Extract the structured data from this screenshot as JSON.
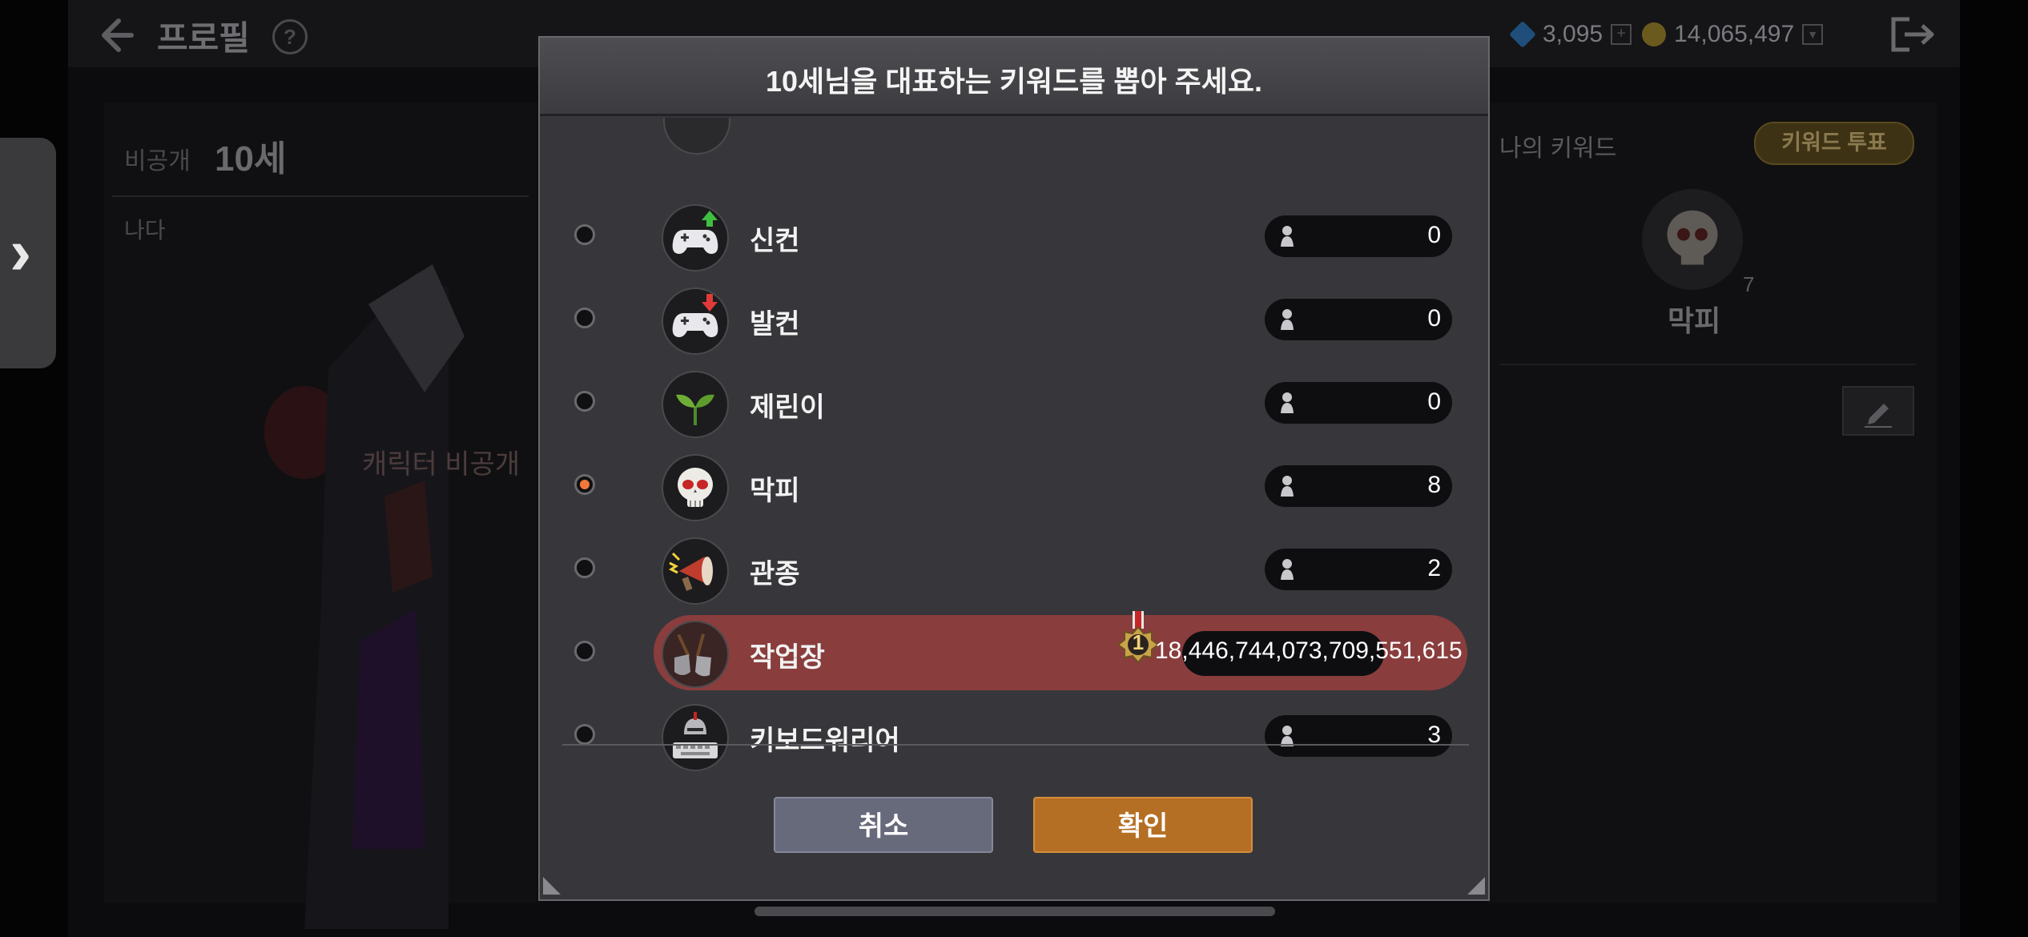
{
  "header": {
    "title": "프로필",
    "help_label": "?",
    "gems": "3,095",
    "gold": "14,065,497"
  },
  "profile": {
    "private_label": "비공개",
    "character_name": "10세",
    "sub_label": "나다",
    "character_private_text": "캐릭터 비공개"
  },
  "keyword_panel": {
    "my_keyword_label": "나의 키워드",
    "vote_button": "키워드 투표",
    "current_keyword_name": "막피",
    "current_keyword_count": "7"
  },
  "dialog": {
    "title": "10세님을 대표하는 키워드를 뽑아 주세요.",
    "keywords": [
      {
        "label": "신컨",
        "count": "0",
        "icon": "gamepad-up-icon",
        "selected": false
      },
      {
        "label": "발컨",
        "count": "0",
        "icon": "gamepad-down-icon",
        "selected": false
      },
      {
        "label": "제린이",
        "count": "0",
        "icon": "sprout-icon",
        "selected": false
      },
      {
        "label": "막피",
        "count": "8",
        "icon": "skull-icon",
        "selected": true
      },
      {
        "label": "관종",
        "count": "2",
        "icon": "megaphone-icon",
        "selected": false
      },
      {
        "label": "작업장",
        "count": "18,446,744,073,709,551,615",
        "icon": "shovel-icon",
        "selected": false,
        "rank": "1"
      },
      {
        "label": "키보드워리어",
        "count": "3",
        "icon": "keyboard-knight-icon",
        "selected": false
      }
    ],
    "cancel_button": "취소",
    "confirm_button": "확인"
  },
  "colors": {
    "radio_selected": "#f2783a",
    "confirm_button": "#b56f24",
    "cancel_button": "#676a7a",
    "winner_highlight": "#8a3d3d"
  }
}
